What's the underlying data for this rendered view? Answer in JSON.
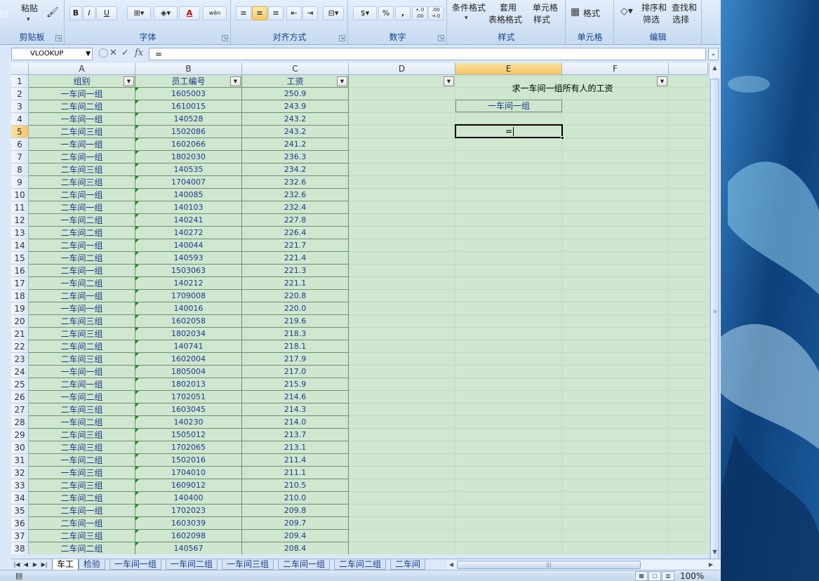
{
  "ribbon": {
    "groups": [
      {
        "label": "剪贴板"
      },
      {
        "label": "字体"
      },
      {
        "label": "对齐方式"
      },
      {
        "label": "数字"
      },
      {
        "label": "样式"
      },
      {
        "label": "单元格"
      },
      {
        "label": "编辑"
      }
    ],
    "paste_label": "粘贴",
    "bold": "B",
    "italic": "I",
    "underline": "U",
    "font_color_label": "A",
    "phonetic_label": "wén",
    "percent": "%",
    "comma": ",",
    "inc_decimal": "+.0 .00",
    "dec_decimal": ".00 →.0",
    "conditional_format": "条件格式",
    "table_format_top": "套用",
    "table_format_bottom": "表格格式",
    "cell_style_top": "单元格",
    "cell_style_bottom": "样式",
    "format_label": "格式",
    "sort_filter_top": "排序和",
    "sort_filter_bottom": "筛选",
    "find_select_top": "查找和",
    "find_select_bottom": "选择"
  },
  "formula_bar": {
    "name_box": "VLOOKUP",
    "cancel": "✕",
    "enter": "✓",
    "fx": "fx",
    "formula": "="
  },
  "desktop_num": "20",
  "columns": [
    "A",
    "B",
    "C",
    "D",
    "E",
    "F"
  ],
  "header_row": {
    "a": "组别",
    "b": "员工编号",
    "c": "工资"
  },
  "rows": [
    {
      "n": "2",
      "a": "一车间一组",
      "b": "1605003",
      "c": "250.9"
    },
    {
      "n": "3",
      "a": "二车间二组",
      "b": "1610015",
      "c": "243.9"
    },
    {
      "n": "4",
      "a": "一车间一组",
      "b": "140528",
      "c": "243.2"
    },
    {
      "n": "5",
      "a": "二车间三组",
      "b": "1502086",
      "c": "243.2"
    },
    {
      "n": "6",
      "a": "一车间一组",
      "b": "1602066",
      "c": "241.2"
    },
    {
      "n": "7",
      "a": "二车间一组",
      "b": "1802030",
      "c": "236.3"
    },
    {
      "n": "8",
      "a": "二车间三组",
      "b": "140535",
      "c": "234.2"
    },
    {
      "n": "9",
      "a": "二车间三组",
      "b": "1704007",
      "c": "232.6"
    },
    {
      "n": "10",
      "a": "二车间一组",
      "b": "140085",
      "c": "232.6"
    },
    {
      "n": "11",
      "a": "二车间一组",
      "b": "140103",
      "c": "232.4"
    },
    {
      "n": "12",
      "a": "一车间二组",
      "b": "140241",
      "c": "227.8"
    },
    {
      "n": "13",
      "a": "二车间二组",
      "b": "140272",
      "c": "226.4"
    },
    {
      "n": "14",
      "a": "二车间一组",
      "b": "140044",
      "c": "221.7"
    },
    {
      "n": "15",
      "a": "一车间二组",
      "b": "140593",
      "c": "221.4"
    },
    {
      "n": "16",
      "a": "二车间一组",
      "b": "1503063",
      "c": "221.3"
    },
    {
      "n": "17",
      "a": "一车间二组",
      "b": "140212",
      "c": "221.1"
    },
    {
      "n": "18",
      "a": "二车间一组",
      "b": "1709008",
      "c": "220.8"
    },
    {
      "n": "19",
      "a": "一车间一组",
      "b": "140016",
      "c": "220.0"
    },
    {
      "n": "20",
      "a": "二车间三组",
      "b": "1602058",
      "c": "219.6"
    },
    {
      "n": "21",
      "a": "二车间三组",
      "b": "1802034",
      "c": "218.3"
    },
    {
      "n": "22",
      "a": "二车间二组",
      "b": "140741",
      "c": "218.1"
    },
    {
      "n": "23",
      "a": "二车间三组",
      "b": "1602004",
      "c": "217.9"
    },
    {
      "n": "24",
      "a": "一车间一组",
      "b": "1805004",
      "c": "217.0"
    },
    {
      "n": "25",
      "a": "二车间一组",
      "b": "1802013",
      "c": "215.9"
    },
    {
      "n": "26",
      "a": "一车间二组",
      "b": "1702051",
      "c": "214.6"
    },
    {
      "n": "27",
      "a": "二车间三组",
      "b": "1603045",
      "c": "214.3"
    },
    {
      "n": "28",
      "a": "一车间二组",
      "b": "140230",
      "c": "214.0"
    },
    {
      "n": "29",
      "a": "二车间三组",
      "b": "1505012",
      "c": "213.7"
    },
    {
      "n": "30",
      "a": "二车间三组",
      "b": "1702065",
      "c": "213.1"
    },
    {
      "n": "31",
      "a": "一车间二组",
      "b": "1502016",
      "c": "211.4"
    },
    {
      "n": "32",
      "a": "一车间三组",
      "b": "1704010",
      "c": "211.1"
    },
    {
      "n": "33",
      "a": "二车间三组",
      "b": "1609012",
      "c": "210.5"
    },
    {
      "n": "34",
      "a": "二车间二组",
      "b": "140400",
      "c": "210.0"
    },
    {
      "n": "35",
      "a": "二车间一组",
      "b": "1702023",
      "c": "209.8"
    },
    {
      "n": "36",
      "a": "二车间一组",
      "b": "1603039",
      "c": "209.7"
    },
    {
      "n": "37",
      "a": "二车间三组",
      "b": "1602098",
      "c": "209.4"
    },
    {
      "n": "38",
      "a": "二车间二组",
      "b": "140567",
      "c": "208.4"
    }
  ],
  "e_column": {
    "title": "求一车间一组所有人的工资",
    "criteria": "一车间一组",
    "editing_value": "="
  },
  "sheet_tabs": [
    "车工",
    "检验",
    "一车间一组",
    "一车间二组",
    "一车间三组",
    "二车间一组",
    "二车间二组",
    "二车间"
  ],
  "active_tab": 0,
  "status": {
    "zoom": "100%"
  }
}
